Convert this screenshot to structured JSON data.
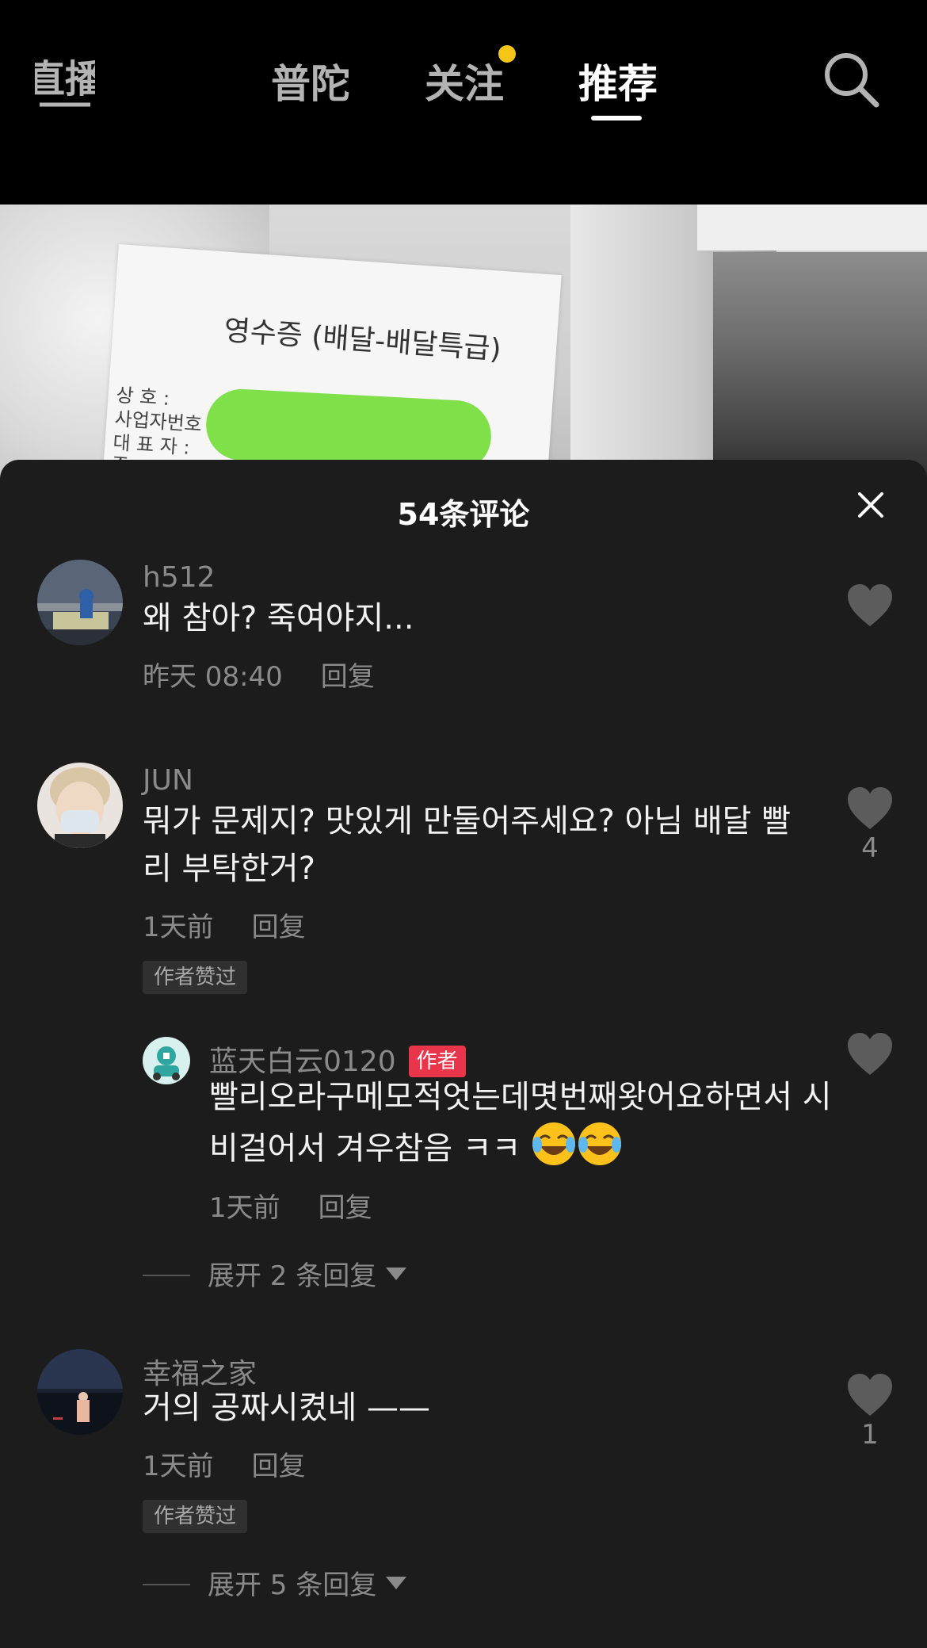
{
  "nav": {
    "live_label": "直播",
    "tabs": [
      {
        "label": "普陀"
      },
      {
        "label": "关注"
      },
      {
        "label": "推荐"
      }
    ],
    "active_tab": "推荐",
    "follow_dot_color": "#f5c518"
  },
  "video": {
    "receipt_title": "영수증 (배달-배달특급)",
    "receipt_lines": [
      "상    호 :",
      "사업자번호 : 37020",
      "대 표 자 :",
      "주"
    ]
  },
  "comments_panel": {
    "title": "54条评论",
    "close_icon": "close-icon",
    "comments": [
      {
        "user": "h512",
        "text": "왜 참아? 죽여야지...",
        "time": "昨天 08:40",
        "reply_label": "回复",
        "likes": ""
      },
      {
        "user": "JUN",
        "text": "뭐가 문제지? 맛있게 만둘어주세요? 아님 배달 빨리 부탁한거?",
        "time": "1天前",
        "reply_label": "回复",
        "likes": "4",
        "badge": "作者赞过",
        "reply": {
          "user": "蓝天白云0120",
          "author_tag": "作者",
          "text": "빨리오라구메모적엇는데몃번째왓어요하면서 시비걸어서 겨우참음 ㅋㅋ",
          "emojis": [
            "laughing-crying-emoji",
            "laughing-crying-emoji"
          ],
          "time": "1天前",
          "reply_label": "回复"
        },
        "expand_label": "展开 2 条回复"
      },
      {
        "user": "幸福之家",
        "text": "거의 공짜시켰네 ——",
        "time": "1天前",
        "reply_label": "回复",
        "likes": "1",
        "badge": "作者赞过",
        "expand_label": "展开 5 条回复"
      }
    ]
  },
  "colors": {
    "panel_bg": "#1c1c1c",
    "author_tag": "#e8354a",
    "muted_text": "#8a8a8a"
  }
}
